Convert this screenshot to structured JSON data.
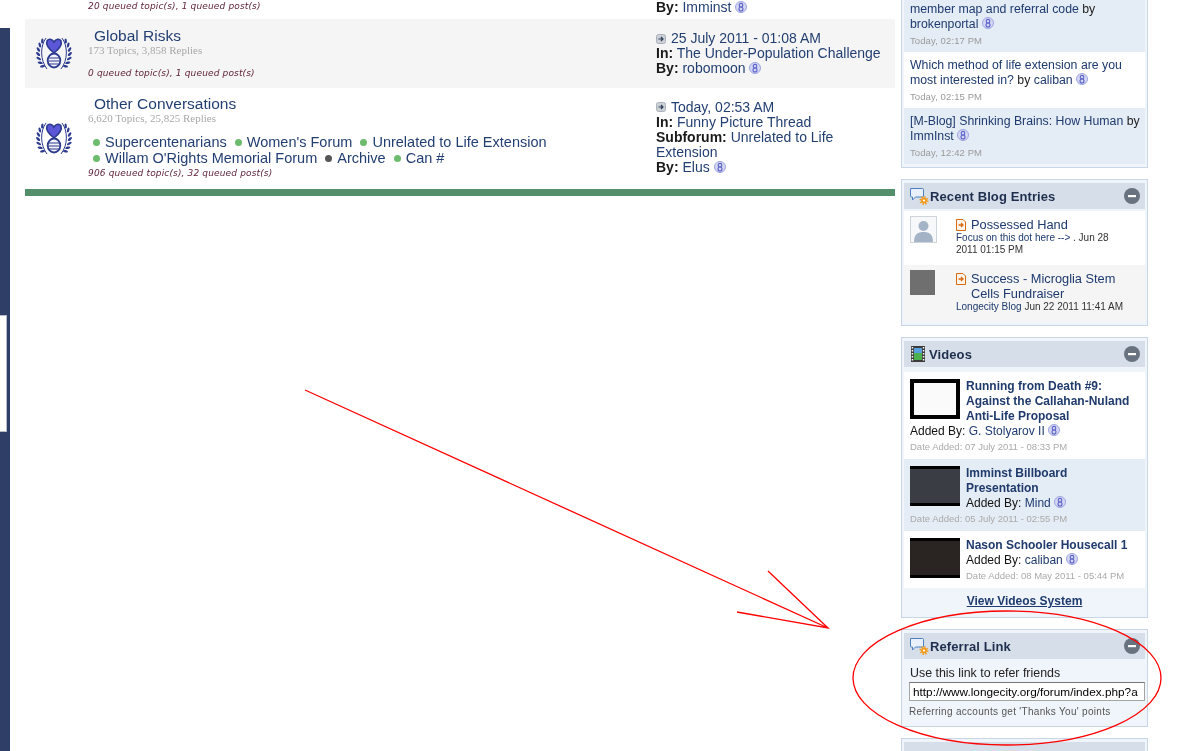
{
  "forum": {
    "rows": [
      {
        "queued": "20 queued topic(s), 1 queued post(s)",
        "last_post": {
          "lines": [
            {
              "kind": "user",
              "label": "By:",
              "value": "Imminst"
            }
          ]
        }
      },
      {
        "title": "Global Risks",
        "stats": "173 Topics, 3,858 Replies",
        "queued": "0 queued topic(s), 1 queued post(s)",
        "last_post": {
          "date": "25 July 2011 - 01:08 AM",
          "lines": [
            {
              "kind": "link",
              "label": "In:",
              "value": "The Under-Population Challenge"
            },
            {
              "kind": "user",
              "label": "By:",
              "value": "robomoon"
            }
          ]
        }
      },
      {
        "title": "Other Conversations",
        "stats": "6,620 Topics, 25,825 Replies",
        "subforums": [
          {
            "name": "Supercentenarians",
            "color": "#6dbb6d"
          },
          {
            "name": "Women's Forum",
            "color": "#6dbb6d"
          },
          {
            "name": "Unrelated to Life Extension",
            "color": "#6dbb6d"
          },
          {
            "name": "Willam O'Rights Memorial Forum",
            "color": "#6dbb6d"
          },
          {
            "name": "Archive",
            "color": "#555555"
          },
          {
            "name": "Can #",
            "color": "#6dbb6d"
          }
        ],
        "queued": "906 queued topic(s), 32 queued post(s)",
        "last_post": {
          "date": "Today, 02:53 AM",
          "lines": [
            {
              "kind": "link",
              "label": "In:",
              "value": "Funny Picture Thread"
            },
            {
              "kind": "link",
              "label": "Subforum:",
              "value": "Unrelated to Life Extension"
            },
            {
              "kind": "user",
              "label": "By:",
              "value": "Elus"
            }
          ]
        }
      }
    ]
  },
  "sidebar": {
    "panels": [
      {
        "kind": "recent_topics",
        "items": [
          {
            "title": "member map and referral code",
            "by": "by",
            "author": "brokenportal",
            "time": "Today, 02:17 PM"
          },
          {
            "title": "Which method of life extension are you most interested in?",
            "by": "by",
            "author": "caliban",
            "time": "Today, 02:15 PM"
          },
          {
            "title": "[M-Blog] Shrinking Brains: How Human",
            "by": "by",
            "author": "ImmInst",
            "time": "Today, 12:42 PM"
          }
        ]
      },
      {
        "kind": "blog",
        "title": "Recent Blog Entries",
        "entries": [
          {
            "kind": "silhouette",
            "title": "Possessed Hand",
            "blog": "Focus on this dot here -->",
            "date": ". Jun 28 2011 01:15 PM"
          },
          {
            "kind": "photo",
            "title": "Success - Microglia Stem Cells Fundraiser",
            "blog": "Longecity Blog",
            "date": "Jun 22 2011 11:41 AM"
          }
        ]
      },
      {
        "kind": "videos",
        "title": "Videos",
        "videos": [
          {
            "title": "Running from Death #9: Against the Callahan-Nuland Anti-Life Proposal",
            "added_label": "Added By:",
            "added_by": "G. Stolyarov II",
            "date": "Date Added: 07 July 2011 - 08:33 PM"
          },
          {
            "title": "Imminst Billboard Presentation",
            "added_label": "Added By:",
            "added_by": "Mind",
            "date": "Date Added: 05 July 2011 - 02:55 PM"
          },
          {
            "title": "Nason Schooler Housecall 1",
            "added_label": "Added By:",
            "added_by": "caliban",
            "date": "Date Added: 08 May 2011 - 05:44 PM"
          }
        ],
        "footer_link": "View Videos System"
      },
      {
        "kind": "referral",
        "title": "Referral Link",
        "label": "Use this link to refer friends",
        "value": "http://www.longecity.org/forum/index.php?a",
        "note": "Referring accounts get 'Thanks You' points"
      },
      {
        "kind": "cut"
      }
    ]
  },
  "annotations": [
    {
      "kind": "arrow"
    },
    {
      "kind": "ellipse"
    }
  ]
}
